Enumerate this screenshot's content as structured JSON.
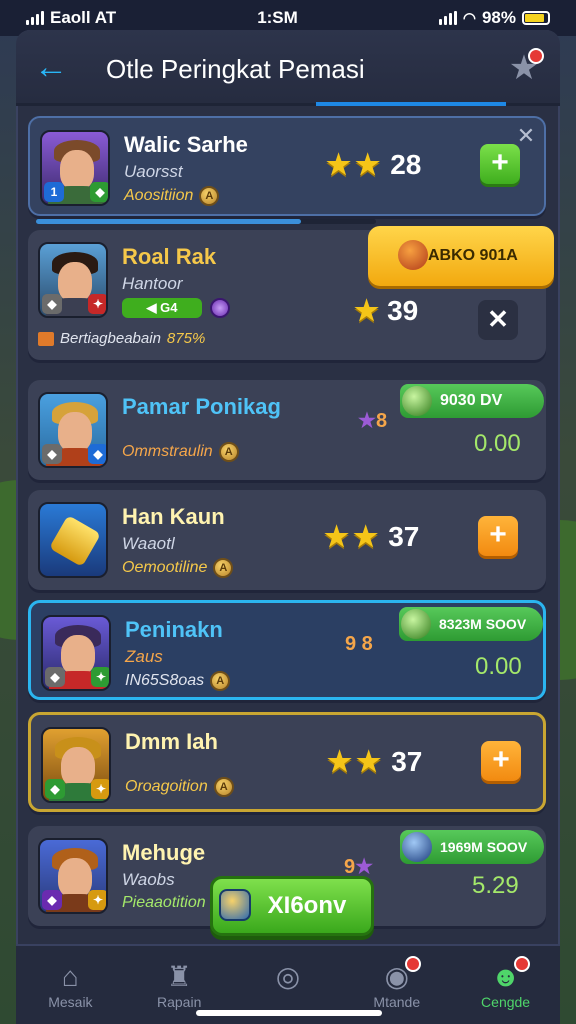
{
  "status_bar": {
    "carrier": "Eaoll AT",
    "time": "1:SM",
    "battery": "98%",
    "battery_level": 0.85
  },
  "header": {
    "title": "Otle Peringkat Pemasi",
    "back_icon": "arrow-left-icon",
    "star_icon": "star-icon"
  },
  "rows": [
    {
      "name": "Walic Sarhe",
      "sub": "Uaorsst",
      "tag": "Aoositiion",
      "stars": 2,
      "score": "28",
      "action": "plus",
      "progress": 0.78
    },
    {
      "name": "Roal Rak",
      "sub": "Hantoor",
      "chip": "G4",
      "tag": "Bertiagbeabain",
      "tag_value": "875%",
      "banner": "ABKO 901A",
      "stars": 1,
      "score": "39",
      "action": "close"
    },
    {
      "name": "Pamar Ponikag",
      "tag": "Ommstraulin",
      "rating_text": "8",
      "pill": "9030 DV",
      "value": "0.00"
    },
    {
      "name": "Han Kaun",
      "sub": "Waaotl",
      "tag": "Oemootiline",
      "stars": 2,
      "score": "37",
      "action": "plus"
    },
    {
      "name": "Peninakn",
      "sub": "Zaus",
      "tag": "IN65S8oas",
      "rating_text": "9 8",
      "pill": "8323M SOOV",
      "value": "0.00"
    },
    {
      "name": "Dmm Iah",
      "tag": "Oroagoition",
      "stars": 2,
      "score": "37",
      "action": "plus"
    },
    {
      "name": "Mehuge",
      "sub": "Waobs",
      "tag": "Pieaaotition",
      "rating_text": "9",
      "pill": "1969M SOOV",
      "value": "5.29"
    }
  ],
  "float_button": {
    "label": "XI6onv"
  },
  "bottom_nav": [
    {
      "label": "Mesaik",
      "icon": "home-icon"
    },
    {
      "label": "Rapain",
      "icon": "trophy-icon"
    },
    {
      "label": "",
      "icon": "compass-icon"
    },
    {
      "label": "Mtande",
      "icon": "target-icon"
    },
    {
      "label": "Cengde",
      "icon": "profile-icon"
    }
  ],
  "colors": {
    "accent": "#29b6f6",
    "green": "#4fd56a",
    "orange": "#f28a10",
    "gold": "#f5c518"
  }
}
